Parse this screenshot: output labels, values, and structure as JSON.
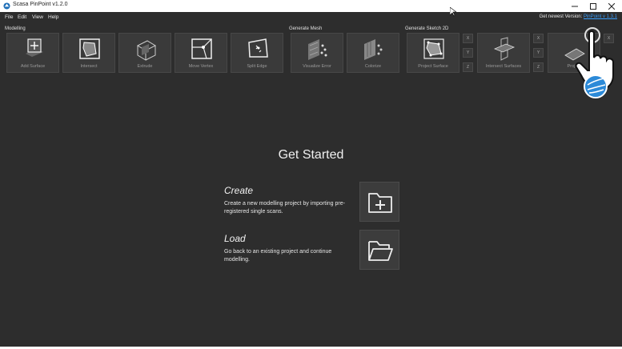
{
  "window": {
    "title": "Scasa PinPoint v1.2.0"
  },
  "menu": {
    "items": [
      "File",
      "Edit",
      "View",
      "Help"
    ]
  },
  "update_notice": {
    "text": "Get newest Version: ",
    "link": "PinPoint v 1.3.1"
  },
  "toolbar": {
    "groups": [
      {
        "label": "Modelling",
        "tools": [
          "Add Surface",
          "Intersect",
          "Extrude",
          "Move Vertex",
          "Split Edge"
        ]
      },
      {
        "label": "Generate Mesh",
        "tools": [
          "Visualize Error",
          "Colorize"
        ]
      },
      {
        "label": "Generate Sketch 2D",
        "tools": [
          "Project Surface",
          "Intersect Surfaces",
          "Project"
        ]
      }
    ],
    "axis_labels": [
      "X",
      "Y",
      "Z"
    ]
  },
  "main": {
    "heading": "Get Started",
    "create": {
      "title": "Create",
      "description": "Create a new modelling project by importing pre-registered single scans."
    },
    "load": {
      "title": "Load",
      "description": "Go back to an existing project and continue modelling."
    }
  },
  "icons": {
    "app": "app-logo-icon",
    "minimize": "minimize-icon",
    "maximize": "maximize-icon",
    "close": "close-icon",
    "create": "folder-plus-icon",
    "load": "folder-open-icon",
    "overlay": "tap-hand-icon"
  },
  "colors": {
    "background": "#2d2d2d",
    "tool_bg": "#3a3a3a",
    "link": "#3aa0ff"
  }
}
